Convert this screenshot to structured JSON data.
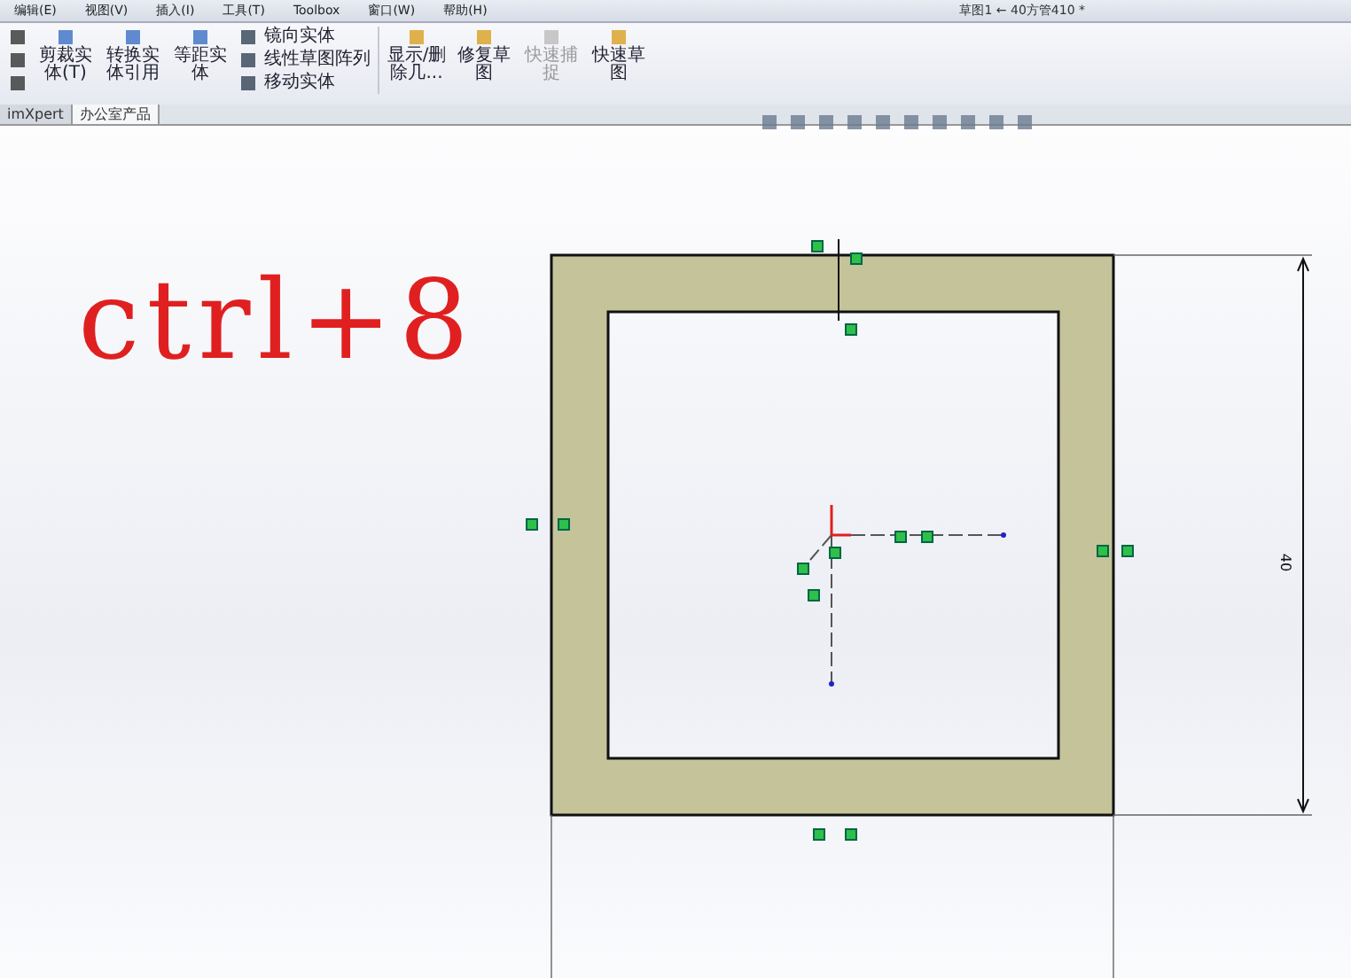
{
  "menu": [
    {
      "label": "编辑(E)"
    },
    {
      "label": "视图(V)"
    },
    {
      "label": "插入(I)"
    },
    {
      "label": "工具(T)"
    },
    {
      "label": "Toolbox"
    },
    {
      "label": "窗口(W)"
    },
    {
      "label": "帮助(H)"
    }
  ],
  "title": "草图1 ← 40方管410 *",
  "ribbon": {
    "large_buttons": [
      {
        "label": "剪裁实体(T)"
      },
      {
        "label": "转换实体引用"
      },
      {
        "label": "等距实体"
      }
    ],
    "stacked": [
      {
        "label": "镜向实体"
      },
      {
        "label": "线性草图阵列"
      },
      {
        "label": "移动实体"
      }
    ],
    "more_buttons": [
      {
        "label": "显示/删除几...",
        "disabled": false
      },
      {
        "label": "修复草图",
        "disabled": false
      },
      {
        "label": "快速捕捉",
        "disabled": true
      },
      {
        "label": "快速草图",
        "disabled": false
      }
    ]
  },
  "tabs": [
    {
      "label": "imXpert",
      "selected": false
    },
    {
      "label": "办公室产品",
      "selected": true
    }
  ],
  "annotation": "ctrl+8",
  "dimension": "40"
}
